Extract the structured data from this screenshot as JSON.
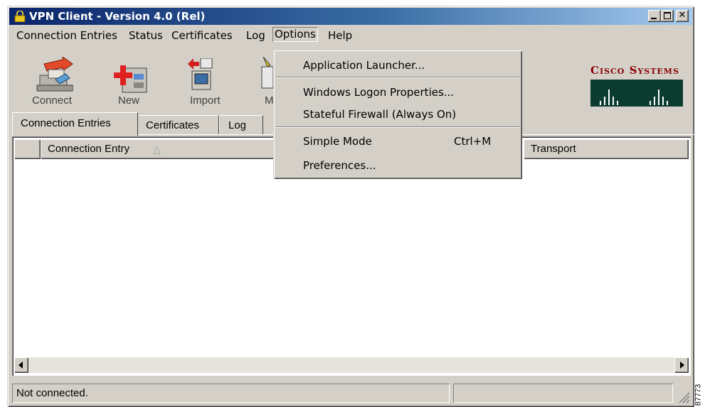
{
  "window": {
    "title": "VPN Client - Version 4.0 (Rel)"
  },
  "menubar": [
    {
      "label": "Connection Entries"
    },
    {
      "label": "Status"
    },
    {
      "label": "Certificates"
    },
    {
      "label": "Log"
    },
    {
      "label": "Options"
    },
    {
      "label": "Help"
    }
  ],
  "toolbar": {
    "connect": "Connect",
    "new": "New",
    "import": "Import",
    "modify_partial": "M"
  },
  "brand": {
    "logo_text": "Cisco Systems",
    "color": "#8b0000"
  },
  "tabs": [
    "Connection Entries",
    "Certificates",
    "Log"
  ],
  "columns": [
    "Connection Entry",
    "Transport"
  ],
  "options_menu": {
    "items": [
      {
        "label": "Application Launcher...",
        "shortcut": ""
      },
      {
        "label": "Windows Logon Properties...",
        "shortcut": ""
      },
      {
        "label": "Stateful Firewall (Always On)",
        "shortcut": ""
      },
      {
        "label": "Simple Mode",
        "shortcut": "Ctrl+M"
      },
      {
        "label": "Preferences...",
        "shortcut": ""
      }
    ]
  },
  "status": {
    "text": "Not connected."
  },
  "figure_id": "87773",
  "colors": {
    "title_start": "#0a246a",
    "title_end": "#a6caf0",
    "chrome": "#d4d0c8",
    "accent_red": "#cc0000"
  }
}
